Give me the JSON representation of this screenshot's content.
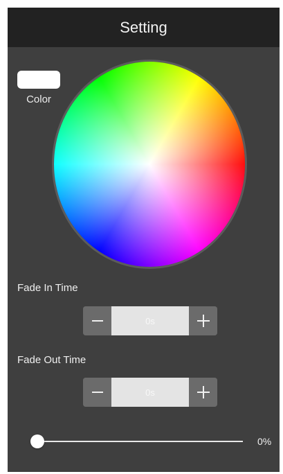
{
  "header": {
    "title": "Setting"
  },
  "color": {
    "label": "Color",
    "selected": "#ffffff"
  },
  "fade_in": {
    "label": "Fade In Time",
    "value": "0s"
  },
  "fade_out": {
    "label": "Fade Out Time",
    "value": "0s"
  },
  "slider": {
    "value_text": "0%",
    "value": 0
  },
  "icons": {
    "decrease": "minus-icon",
    "increase": "plus-icon"
  }
}
